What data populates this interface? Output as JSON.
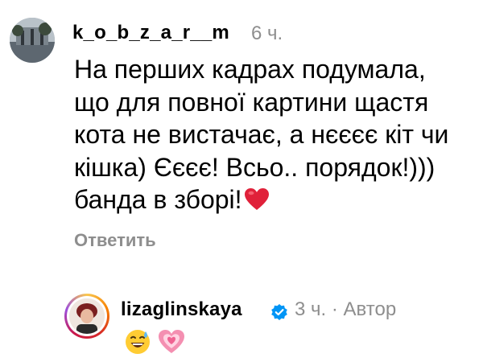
{
  "comment": {
    "username": "k_o_b_z_a_r__m",
    "time": "6 ч.",
    "lines": [
      "На перших кадрах подумала,",
      "що для повної картини щастя",
      "кота не вистачає, а нєєєє кіт чи",
      "кішка) Єєєє! Всьо.. порядок!)))",
      "банда в зборі!"
    ],
    "trailing_emoji": "red-heart-icon",
    "reply_label": "Ответить"
  },
  "reply": {
    "username": "lizaglinskaya",
    "verified_icon": "verified-badge-icon",
    "time": "3 ч.",
    "separator": "·",
    "author_label": "Автор",
    "emojis": [
      "sweat-smile-icon",
      "growing-heart-icon"
    ]
  },
  "colors": {
    "text": "#000000",
    "muted": "#8e8e8e",
    "verified": "#0095f6",
    "heart_red": "#e0213a",
    "heart_pink": "#f48fb1"
  }
}
